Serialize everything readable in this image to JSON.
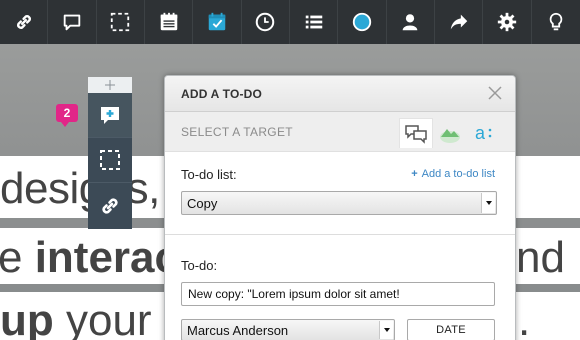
{
  "background_page": {
    "line1": "designs,",
    "line2_pre": "e ",
    "line2_bold": "interac",
    "line2_right": "nd",
    "line3_bold": "up",
    "line3_rest": " your ("
  },
  "toolbar": {
    "items": [
      {
        "icon": "link-icon"
      },
      {
        "icon": "comment-icon"
      },
      {
        "icon": "selection-icon"
      },
      {
        "icon": "notes-icon"
      },
      {
        "icon": "todo-calendar-icon",
        "active": true
      },
      {
        "icon": "clock-icon"
      },
      {
        "icon": "list-icon"
      },
      {
        "icon": "color-dot-icon"
      },
      {
        "icon": "user-icon"
      },
      {
        "icon": "share-icon"
      },
      {
        "icon": "gear-icon"
      },
      {
        "icon": "lightbulb-icon"
      }
    ],
    "accent": "#2ba8d6"
  },
  "palette": {
    "badge_count": "2",
    "items": [
      "add-comment-icon",
      "selection-icon",
      "link-icon"
    ]
  },
  "dialog": {
    "title": "ADD A TO-DO",
    "target_label": "SELECT A TARGET",
    "targets": [
      "chat-icon",
      "basecamp-icon",
      "asana-icon"
    ],
    "todo_list_label": "To-do list:",
    "add_link": "Add a to-do list",
    "add_link_plus": "+",
    "todo_list_value": "Copy",
    "todo_label": "To-do:",
    "todo_value": "New copy: \"Lorem ipsum dolor sit amet!",
    "assignee_value": "Marcus Anderson",
    "date_button": "DATE"
  }
}
